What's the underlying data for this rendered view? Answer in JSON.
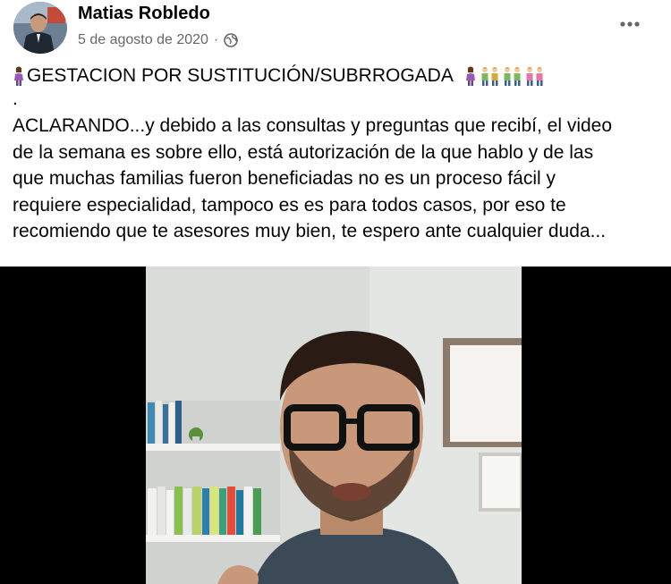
{
  "post": {
    "author_name": "Matias Robledo",
    "date": "5 de agosto de 2020",
    "separator": "·",
    "privacy_icon": "globe-icon",
    "more_icon": "more-options-icon",
    "title": "GESTACION POR SUSTITUCIÓN/SUBRROGADA",
    "title_emojis": [
      "pregnant-woman-emoji",
      "pregnant-woman-emoji",
      "family-emoji",
      "family-emoji",
      "family-emoji"
    ],
    "dot_line": ".",
    "body_lines": [
      "ACLARANDO...y debido a las consultas y preguntas que recibí, el video",
      "de la semana es sobre ello, está autorización de la que hablo y de las",
      "que muchas familias fueron beneficiadas  no es un proceso fácil y",
      "requiere especialidad, tampoco es es para todos casos, por eso te",
      "recomiendo que te asesores muy bien, te espero ante cualquier duda..."
    ]
  },
  "colors": {
    "text_primary": "#050505",
    "text_secondary": "#65676b",
    "video_bg": "#000000"
  }
}
